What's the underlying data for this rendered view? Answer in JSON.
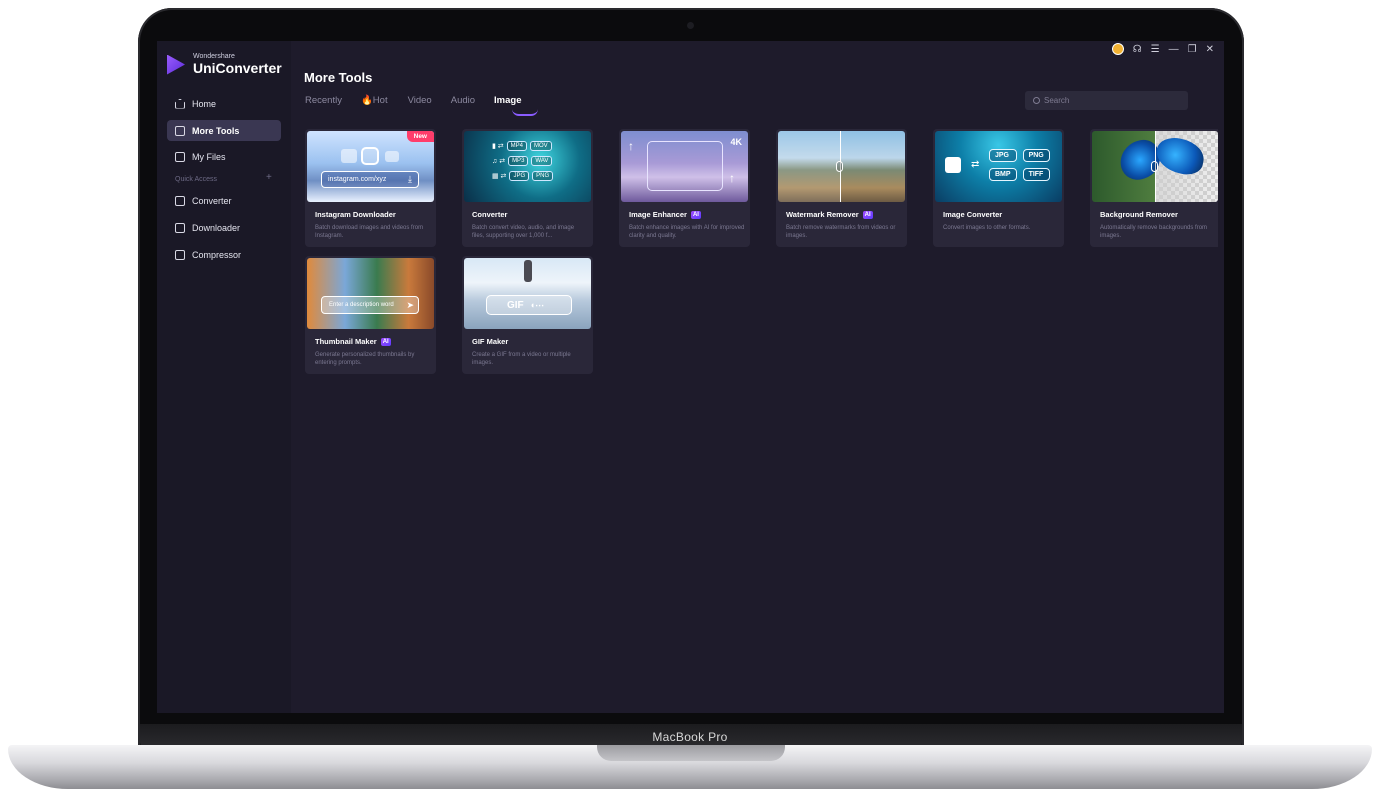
{
  "device_label": "MacBook Pro",
  "app": {
    "brand_small": "Wondershare",
    "brand_name": "UniConverter"
  },
  "sidebar": {
    "items": [
      {
        "label": "Home",
        "icon": "home-icon"
      },
      {
        "label": "More Tools",
        "icon": "toolbox-icon",
        "active": true
      },
      {
        "label": "My Files",
        "icon": "files-icon"
      }
    ],
    "quick_access_label": "Quick Access",
    "quick_access_add": "+",
    "quick_items": [
      {
        "label": "Converter",
        "icon": "converter-icon"
      },
      {
        "label": "Downloader",
        "icon": "downloader-icon"
      },
      {
        "label": "Compressor",
        "icon": "compressor-icon"
      }
    ]
  },
  "header": {
    "title": "More Tools",
    "tabs": [
      "Recently",
      "🔥Hot",
      "Video",
      "Audio",
      "Image"
    ],
    "active_tab": "Image",
    "search_placeholder": "Search"
  },
  "window_controls": [
    "avatar",
    "headset-icon",
    "menu-icon",
    "minimize-icon",
    "restore-icon",
    "close-icon"
  ],
  "cards": [
    {
      "title": "Instagram Downloader",
      "ai": false,
      "badge": "New",
      "desc": "Batch download images and videos from Instagram.",
      "thumb_text": "instagram.com/xyz"
    },
    {
      "title": "Converter",
      "ai": false,
      "desc": "Batch convert video, audio, and image files, supporting over 1,000 f...",
      "formats": [
        "MP4",
        "MOV",
        "MP3",
        "WAV",
        "JPG",
        "PNG"
      ]
    },
    {
      "title": "Image Enhancer",
      "ai": true,
      "ai_label": "AI",
      "desc": "Batch enhance images with AI for improved clarity and quality.",
      "thumb_text": "4K"
    },
    {
      "title": "Watermark Remover",
      "ai": true,
      "ai_label": "AI",
      "desc": "Batch remove watermarks from videos or images."
    },
    {
      "title": "Image Converter",
      "ai": false,
      "desc": "Convert images to other formats.",
      "formats": [
        "JPG",
        "PNG",
        "BMP",
        "TIFF"
      ]
    },
    {
      "title": "Background Remover",
      "ai": false,
      "desc": "Automatically remove backgrounds from images."
    },
    {
      "title": "Thumbnail Maker",
      "ai": true,
      "ai_label": "AI",
      "desc": "Generate personalized thumbnails by entering prompts.",
      "thumb_text": "Enter a description word"
    },
    {
      "title": "GIF Maker",
      "ai": false,
      "desc": "Create a GIF from a video or multiple images.",
      "thumb_text": "GIF"
    }
  ],
  "colors": {
    "accent": "#8a5cff",
    "bg": "#1e1b2b",
    "sidebar": "#1a1826",
    "card": "#2a2739",
    "new_badge": "#ff3d6b"
  }
}
